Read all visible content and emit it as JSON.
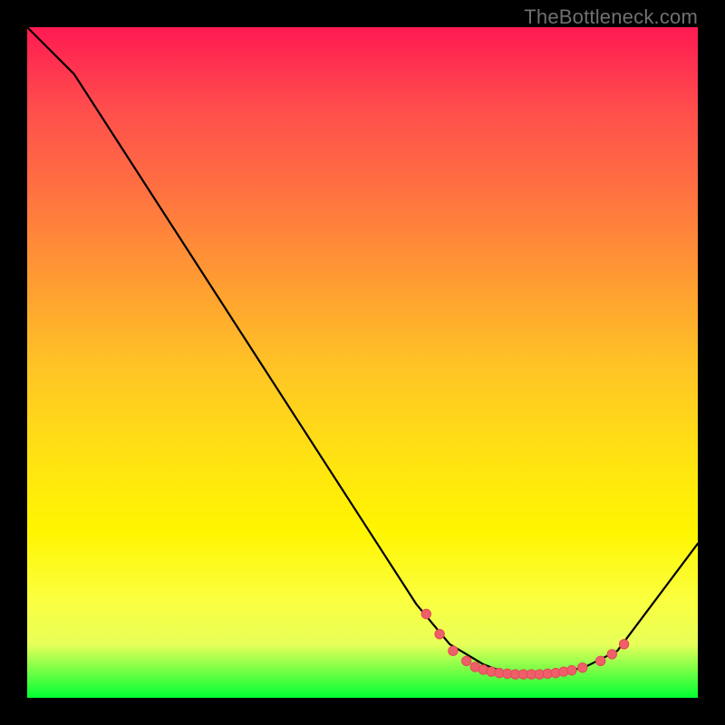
{
  "watermark": "TheBottleneck.com",
  "chart_data": {
    "type": "line",
    "title": "",
    "xlabel": "",
    "ylabel": "",
    "xlim": [
      0,
      1
    ],
    "ylim": [
      0,
      1
    ],
    "curve": [
      {
        "x": 0.0,
        "y": 1.0
      },
      {
        "x": 0.07,
        "y": 0.93
      },
      {
        "x": 0.58,
        "y": 0.14
      },
      {
        "x": 0.63,
        "y": 0.08
      },
      {
        "x": 0.68,
        "y": 0.05
      },
      {
        "x": 0.72,
        "y": 0.035
      },
      {
        "x": 0.78,
        "y": 0.035
      },
      {
        "x": 0.83,
        "y": 0.045
      },
      {
        "x": 0.88,
        "y": 0.07
      },
      {
        "x": 1.0,
        "y": 0.23
      }
    ],
    "markers": [
      {
        "x": 0.595,
        "y": 0.125
      },
      {
        "x": 0.615,
        "y": 0.095
      },
      {
        "x": 0.635,
        "y": 0.07
      },
      {
        "x": 0.655,
        "y": 0.055
      },
      {
        "x": 0.668,
        "y": 0.046
      },
      {
        "x": 0.68,
        "y": 0.042
      },
      {
        "x": 0.692,
        "y": 0.039
      },
      {
        "x": 0.704,
        "y": 0.037
      },
      {
        "x": 0.716,
        "y": 0.036
      },
      {
        "x": 0.728,
        "y": 0.035
      },
      {
        "x": 0.74,
        "y": 0.035
      },
      {
        "x": 0.752,
        "y": 0.035
      },
      {
        "x": 0.764,
        "y": 0.035
      },
      {
        "x": 0.776,
        "y": 0.036
      },
      {
        "x": 0.788,
        "y": 0.037
      },
      {
        "x": 0.8,
        "y": 0.039
      },
      {
        "x": 0.812,
        "y": 0.041
      },
      {
        "x": 0.828,
        "y": 0.045
      },
      {
        "x": 0.855,
        "y": 0.055
      },
      {
        "x": 0.872,
        "y": 0.065
      },
      {
        "x": 0.89,
        "y": 0.08
      }
    ],
    "colors": {
      "curve_stroke": "#000000",
      "marker_fill": "#ef5f6a",
      "marker_stroke": "#e24a57"
    }
  }
}
